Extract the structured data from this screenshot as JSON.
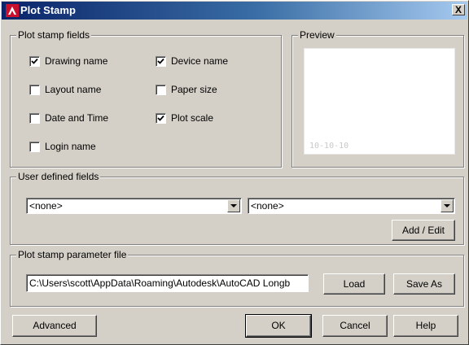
{
  "window": {
    "title": "Plot Stamp",
    "close_label": "X",
    "title_icon": "autocad-logo-icon",
    "accent_color": "#0a246a"
  },
  "fields_group": {
    "label": "Plot stamp fields",
    "items": [
      {
        "label": "Drawing name",
        "checked": true
      },
      {
        "label": "Device name",
        "checked": true
      },
      {
        "label": "Layout name",
        "checked": false
      },
      {
        "label": "Paper size",
        "checked": false
      },
      {
        "label": "Date and Time",
        "checked": false
      },
      {
        "label": "Plot scale",
        "checked": true
      },
      {
        "label": "Login name",
        "checked": false
      }
    ]
  },
  "preview_group": {
    "label": "Preview",
    "sample_text": "10-10-10"
  },
  "user_fields_group": {
    "label": "User defined fields",
    "select1_value": "<none>",
    "select2_value": "<none>",
    "add_edit_label": "Add / Edit"
  },
  "param_file_group": {
    "label": "Plot stamp parameter file",
    "path_value": "C:\\Users\\scott\\AppData\\Roaming\\Autodesk\\AutoCAD Longb",
    "load_label": "Load",
    "save_as_label": "Save As"
  },
  "footer": {
    "advanced_label": "Advanced",
    "ok_label": "OK",
    "cancel_label": "Cancel",
    "help_label": "Help"
  }
}
